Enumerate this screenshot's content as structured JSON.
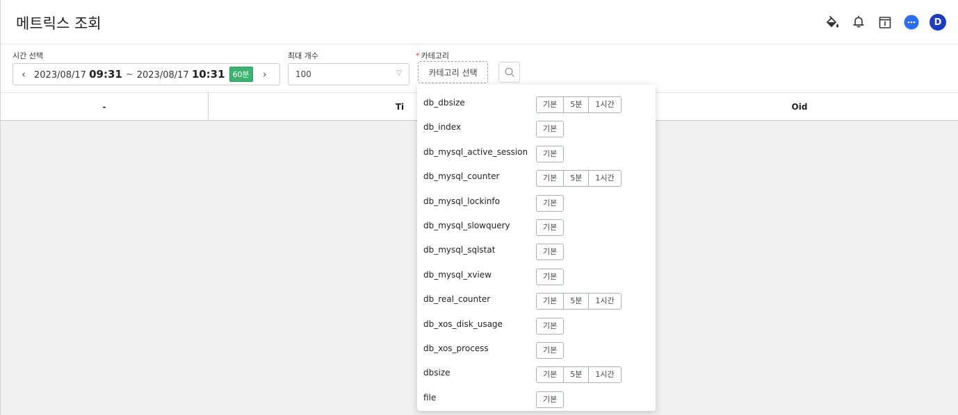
{
  "header": {
    "title": "메트릭스 조회",
    "avatar_letter": "D",
    "icons": [
      "paint-bucket-icon",
      "bell-icon",
      "calendar-info-icon",
      "chat-icon"
    ]
  },
  "filters": {
    "time_label": "시간 선택",
    "time_start_date": "2023/08/17",
    "time_start_hm": "09:31",
    "time_sep": "~",
    "time_end_date": "2023/08/17",
    "time_end_hm": "10:31",
    "duration": "60분",
    "max_label": "최대 개수",
    "max_value": "100",
    "category_label": "카테고리",
    "category_required": "*",
    "category_button": "카테고리 선택"
  },
  "table": {
    "columns": [
      "-",
      "Ti",
      "Oid"
    ]
  },
  "dropdown": {
    "items": [
      {
        "name": "db_dbsize",
        "options": [
          "기본",
          "5분",
          "1시간"
        ]
      },
      {
        "name": "db_index",
        "options": [
          "기본"
        ]
      },
      {
        "name": "db_mysql_active_session",
        "options": [
          "기본"
        ]
      },
      {
        "name": "db_mysql_counter",
        "options": [
          "기본",
          "5분",
          "1시간"
        ]
      },
      {
        "name": "db_mysql_lockinfo",
        "options": [
          "기본"
        ]
      },
      {
        "name": "db_mysql_slowquery",
        "options": [
          "기본"
        ]
      },
      {
        "name": "db_mysql_sqlstat",
        "options": [
          "기본"
        ]
      },
      {
        "name": "db_mysql_xview",
        "options": [
          "기본"
        ]
      },
      {
        "name": "db_real_counter",
        "options": [
          "기본",
          "5분",
          "1시간"
        ]
      },
      {
        "name": "db_xos_disk_usage",
        "options": [
          "기본"
        ]
      },
      {
        "name": "db_xos_process",
        "options": [
          "기본"
        ]
      },
      {
        "name": "dbsize",
        "options": [
          "기본",
          "5분",
          "1시간"
        ]
      },
      {
        "name": "file",
        "options": [
          "기본"
        ]
      }
    ]
  },
  "colors": {
    "accent": "#1d3cbf",
    "duration_badge": "#3cb371",
    "chat_icon": "#2d6df0",
    "table_body_bg": "#f0f0f0"
  }
}
